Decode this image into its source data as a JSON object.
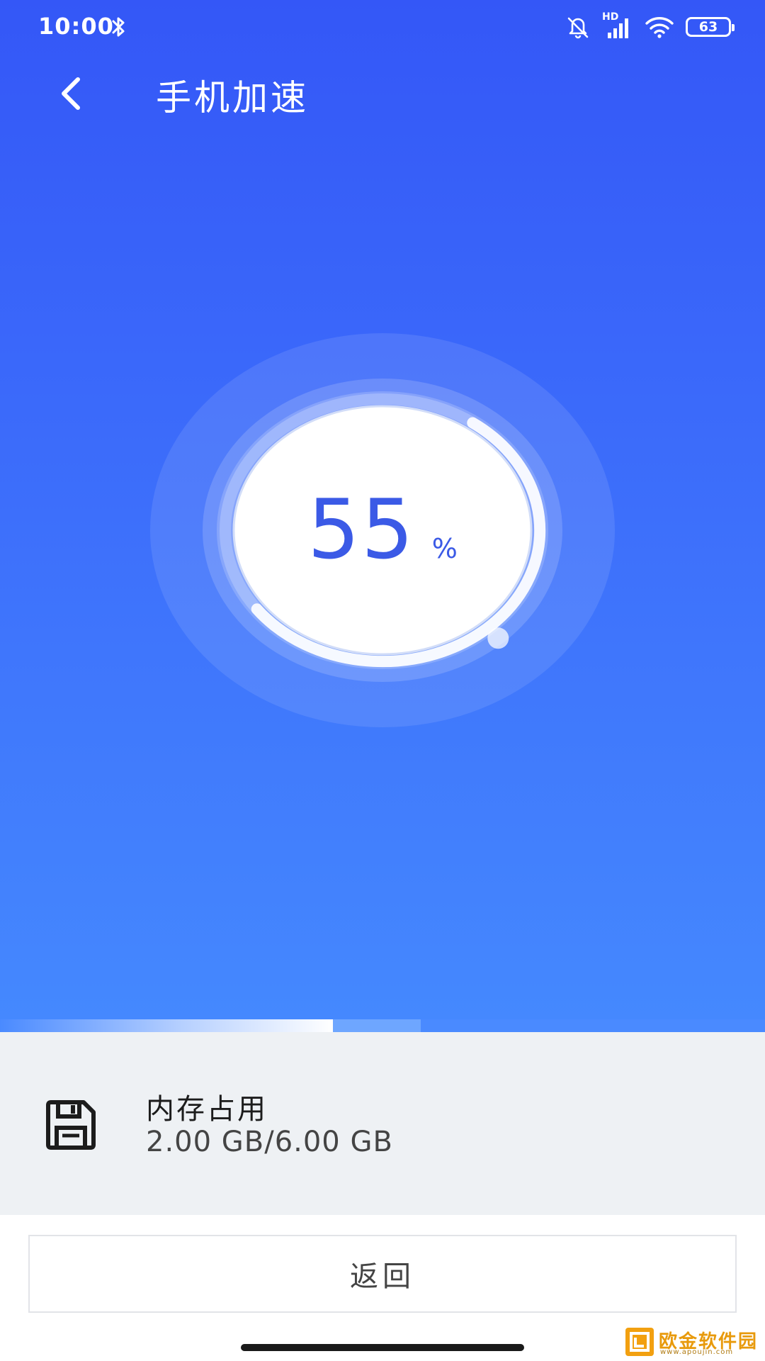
{
  "status_bar": {
    "time": "10:00",
    "battery_level": "63",
    "network_label": "HD",
    "icons": [
      "bluetooth-icon",
      "mute-icon",
      "signal-icon",
      "wifi-icon",
      "battery-icon"
    ]
  },
  "app_bar": {
    "title": "手机加速",
    "back_icon": "back-arrow-icon"
  },
  "gauge": {
    "value": "55",
    "unit": "%",
    "fraction": 0.55
  },
  "progress_strip": {
    "completed_fraction": 0.435,
    "segment_fraction": 0.115
  },
  "memory": {
    "icon": "save-icon",
    "label": "内存占用",
    "value": "2.00 GB/6.00 GB"
  },
  "actions": {
    "return_label": "返回"
  },
  "watermark": {
    "text": "欧金软件园",
    "sub": "www.apoujin.com"
  },
  "colors": {
    "hero_top": "#3457f7",
    "hero_bottom": "#4589fe",
    "accent_text": "#3b5ae6",
    "panel_bg": "#eef1f4"
  }
}
